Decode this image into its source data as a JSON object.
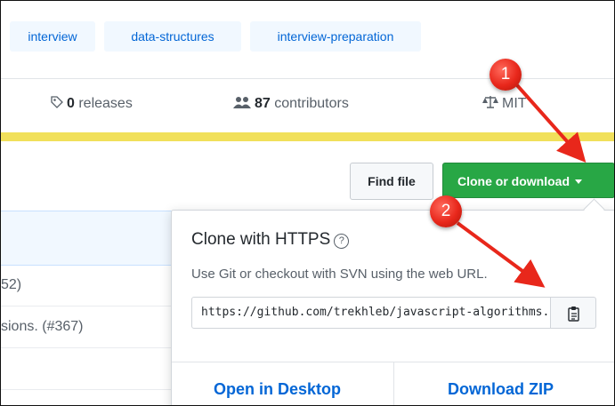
{
  "topics": [
    "interview",
    "data-structures",
    "interview-preparation"
  ],
  "summary": {
    "releases_count": "0",
    "releases_label": " releases",
    "contributors_count": "87",
    "contributors_label": " contributors",
    "license": "MIT"
  },
  "colors": {
    "language_bar": "#f1e05a",
    "clone_button": "#28a745",
    "link": "#0366d6",
    "annotation": "#e8271b"
  },
  "toolbar": {
    "find_file": "Find file",
    "clone_download": "Clone or download"
  },
  "files": {
    "row1": "52)",
    "row2": "sions. (#367)"
  },
  "clone_popover": {
    "title": "Clone with HTTPS",
    "help_glyph": "?",
    "description": "Use Git or checkout with SVN using the web URL.",
    "url": "https://github.com/trekhleb/javascript-algorithms.git",
    "open_desktop": "Open in Desktop",
    "download_zip": "Download ZIP"
  },
  "annotations": {
    "step1": "1",
    "step2": "2"
  },
  "icons": [
    "tag-icon",
    "people-icon",
    "law-icon",
    "caret-down-icon",
    "question-icon",
    "clipboard-icon"
  ]
}
